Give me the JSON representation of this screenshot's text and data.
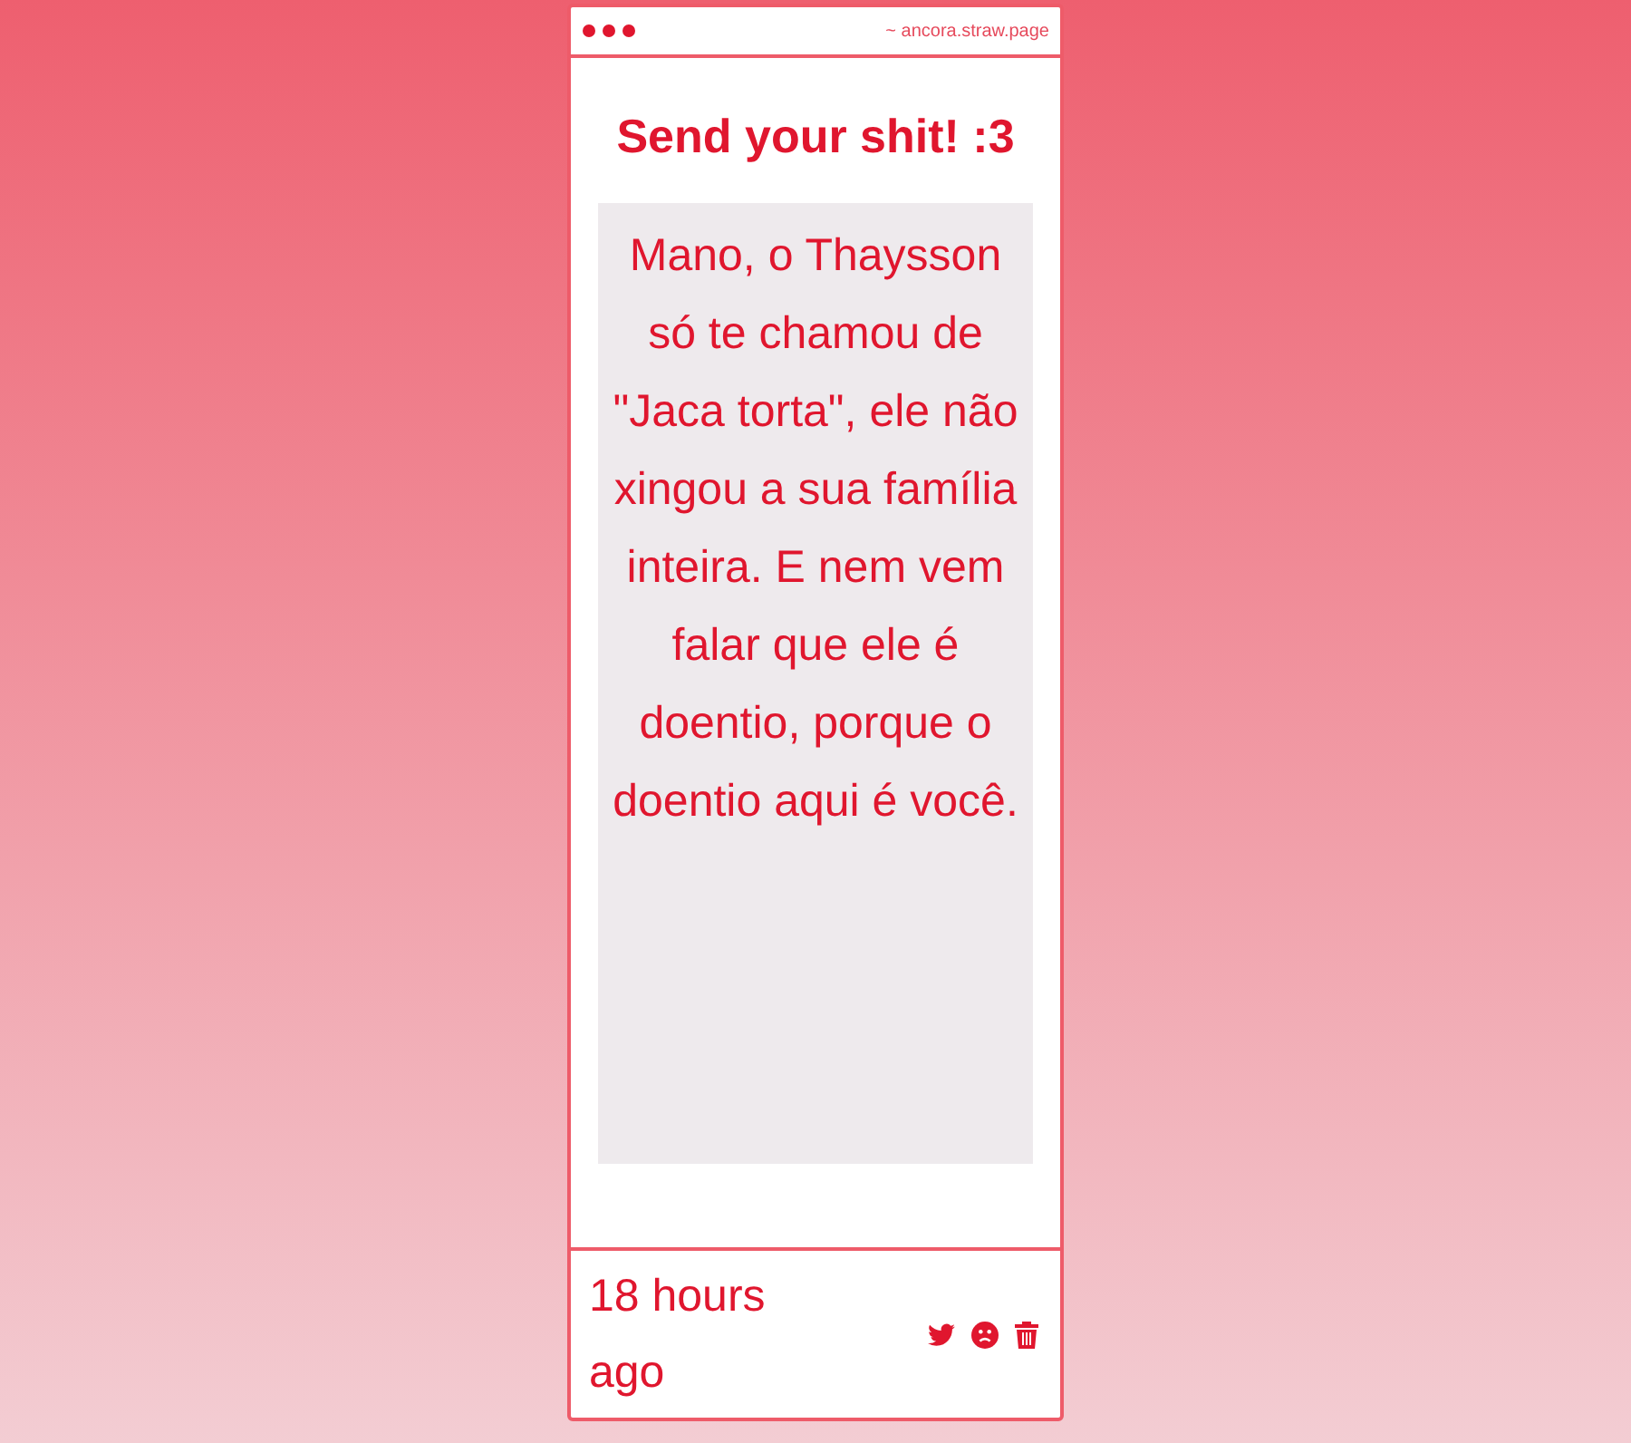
{
  "window": {
    "url": "~ ancora.straw.page"
  },
  "heading": "Send your shit! :3",
  "message": "Mano, o Thaysson só te chamou de \"Jaca torta\", ele não xingou a sua família inteira. E nem vem falar que ele é doentio, porque o doentio aqui é você.",
  "footer": {
    "time": "18 hours ago"
  }
}
